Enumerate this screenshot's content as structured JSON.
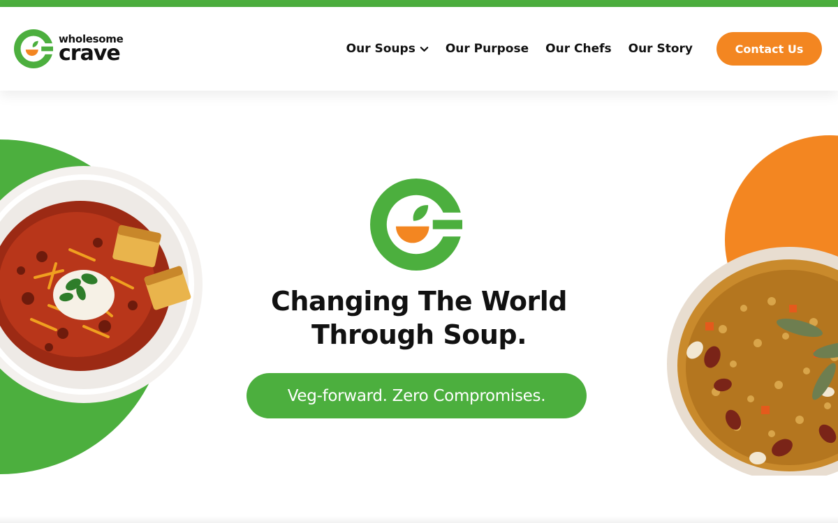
{
  "brand": {
    "name_small": "wholesome",
    "name_big": "crave",
    "colors": {
      "green": "#4caf3e",
      "orange": "#f38621"
    }
  },
  "nav": {
    "items": [
      {
        "label": "Our Soups",
        "has_dropdown": true
      },
      {
        "label": "Our Purpose"
      },
      {
        "label": "Our Chefs"
      },
      {
        "label": "Our Story"
      }
    ],
    "contact_label": "Contact Us"
  },
  "hero": {
    "title_line1": "Changing The World",
    "title_line2": "Through Soup.",
    "tagline": "Veg-forward. Zero Compromises."
  },
  "icons": {
    "logo": "wholesome-crave-logo-icon",
    "dropdown": "chevron-down-icon"
  }
}
